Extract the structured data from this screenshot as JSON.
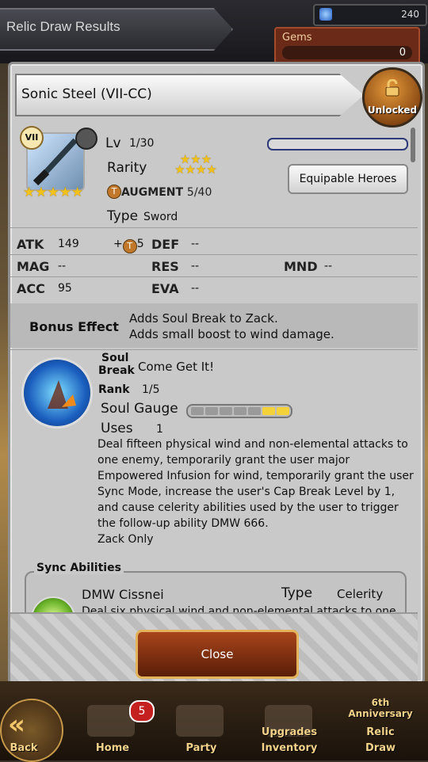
{
  "header": {
    "title": "Relic Draw Results",
    "gem_top_value": "240",
    "gems_label": "Gems",
    "gems_value": "0"
  },
  "relic": {
    "name": "Sonic Steel (VII-CC)",
    "lock_label": "Unlocked",
    "series_badge": "VII",
    "portrait_stars": "★★★★★",
    "level_label": "Lv",
    "level_value": "1/30",
    "level_progress": 0,
    "rarity_label": "Rarity",
    "rarity_stars_top": "★★★",
    "rarity_stars_bottom": "★★★★",
    "equip_button": "Equipable Heroes",
    "augment_label": "AUGMENT",
    "augment_value": "5/40",
    "type_label": "Type",
    "type_value": "Sword"
  },
  "stats": {
    "atk": {
      "label": "ATK",
      "value": "149",
      "bonus": "+",
      "bonus_num": "5"
    },
    "def": {
      "label": "DEF",
      "value": "--"
    },
    "mag": {
      "label": "MAG",
      "value": "--"
    },
    "res": {
      "label": "RES",
      "value": "--"
    },
    "mnd": {
      "label": "MND",
      "value": "--"
    },
    "acc": {
      "label": "ACC",
      "value": "95"
    },
    "eva": {
      "label": "EVA",
      "value": "--"
    }
  },
  "bonus": {
    "title": "Bonus Effect",
    "line1": "Adds Soul Break to Zack.",
    "line2": "Adds small boost to wind damage."
  },
  "soul_break": {
    "label_soul": "Soul",
    "label_break": "Break",
    "name": "Come Get It!",
    "rank_label": "Rank",
    "rank_value": "1/5",
    "gauge_label": "Soul Gauge",
    "gauge_filled": 2,
    "gauge_total": 7,
    "uses_label": "Uses",
    "uses_value": "1",
    "description": "Deal fifteen physical wind and non-elemental attacks to one enemy, temporarily grant the user major Empowered Infusion for wind, temporarily grant the user Sync Mode, increase the user's Cap Break Level by 1, and cause celerity abilities used by the user to trigger the follow-up ability DMW 666.",
    "restriction": "Zack Only"
  },
  "sync": {
    "title": "Sync Abilities",
    "name": "DMW Cissnei",
    "type_label": "Type",
    "type_value": "Celerity",
    "desc": "Deal six physical wind and non-elemental attacks to one"
  },
  "close_button": "Close",
  "nav": {
    "back": "Back",
    "home": "Home",
    "home_badge": "5",
    "party": "Party",
    "upgrades": "Upgrades",
    "inventory": "Inventory",
    "anniv": "6th Anniversary",
    "relic": "Relic",
    "draw": "Draw"
  },
  "colors": {
    "accent_gold": "#f2c21a",
    "close_btn": "#a8441a",
    "gauge_fill": "#f4d23a"
  }
}
